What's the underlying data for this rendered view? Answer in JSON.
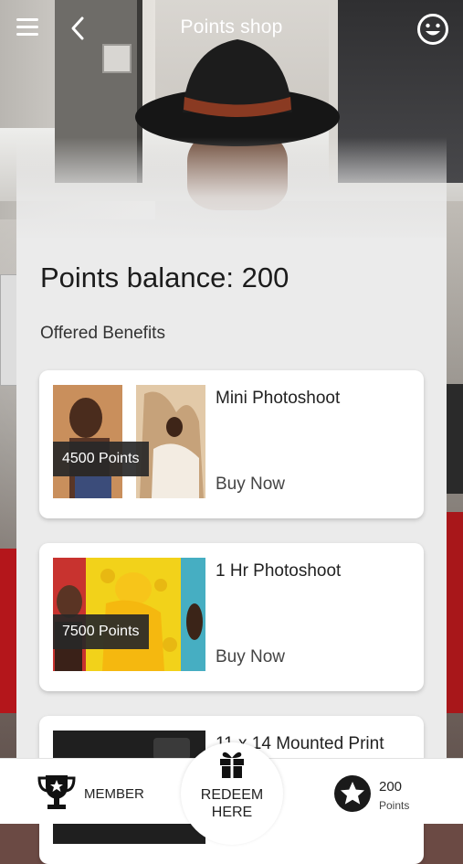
{
  "header": {
    "title": "Points shop",
    "menu_icon": "hamburger-menu-icon",
    "back_icon": "chevron-left-icon",
    "profile_icon": "smiley-face-icon"
  },
  "balance": {
    "text": "Points balance: 200"
  },
  "section": {
    "title": "Offered Benefits"
  },
  "benefits": [
    {
      "title": "Mini Photoshoot",
      "points": "4500 Points",
      "action": "Buy Now"
    },
    {
      "title": "1 Hr Photoshoot",
      "points": "7500 Points",
      "action": "Buy Now"
    },
    {
      "title": "11 x 14 Mounted Print"
    }
  ],
  "bottom_nav": {
    "member_label": "MEMBER",
    "member_icon": "trophy-icon",
    "redeem_label_line1": "REDEEM",
    "redeem_label_line2": "HERE",
    "redeem_icon": "gift-icon",
    "points_value": "200",
    "points_unit": "Points",
    "points_icon": "star-icon"
  },
  "colors": {
    "panel": "#ebebeb",
    "card": "#ffffff",
    "badge": "#282828",
    "text": "#1c1c1c"
  }
}
